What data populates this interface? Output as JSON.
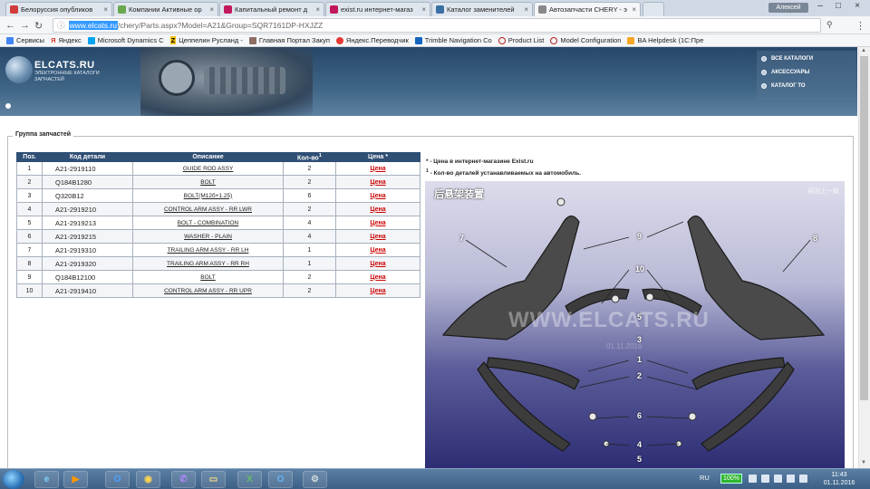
{
  "browser": {
    "tabs": [
      {
        "label": "Белоруссия опубликов",
        "color": "#d23b3b"
      },
      {
        "label": "Компании Активные ор",
        "color": "#6aa84f"
      },
      {
        "label": "Капитальный ремонт д",
        "color": "#c2185b",
        "letter": "D"
      },
      {
        "label": "exist.ru интернет-магаз",
        "color": "#c2185b",
        "letter": "!"
      },
      {
        "label": "Каталог заменителей",
        "color": "#3a6ea5"
      },
      {
        "label": "Автозапчасти CHERY - э",
        "color": "#888888"
      }
    ],
    "account_label": "Алексей",
    "url_host": "www.elcats.ru",
    "url_path": "/chery/Parts.aspx?Model=A21&Group=SQR7161DP-HXJZZ"
  },
  "bookmarks": [
    {
      "label": "Сервисы",
      "color": "#4285f4"
    },
    {
      "label": "Яндекс",
      "color": "#e53935",
      "letter": "Я"
    },
    {
      "label": "Microsoft Dynamics C",
      "color": "#00a4ef"
    },
    {
      "label": "Цеппелин Русланд -",
      "color": "#f4c20d",
      "letter": "Z"
    },
    {
      "label": "Главная Портал Закуп",
      "color": "#8d6e63"
    },
    {
      "label": "Яндекс.Переводчик",
      "color": "#e53935"
    },
    {
      "label": "Trimble Navigation Co",
      "color": "#1565c0"
    },
    {
      "label": "Product List",
      "color": "#b71c1c"
    },
    {
      "label": "Model Configuration",
      "color": "#b71c1c"
    },
    {
      "label": "BA Helpdesk (1С:Пре",
      "color": "#f9a825"
    }
  ],
  "site": {
    "logo": "ELCATS.RU",
    "logo_sub": "ЭЛЕКТРОННЫЕ КАТАЛОГИ ЗАПЧАСТЕЙ",
    "menu": [
      "ВСЕ КАТАЛОГИ",
      "АКСЕССУАРЫ",
      "КАТАЛОГ ТО"
    ]
  },
  "group_legend": "Группа запчастей",
  "table": {
    "headers": [
      "Поз.",
      "Код детали",
      "Описание",
      "Кол-во",
      "Цена *"
    ],
    "qty_sup": "1",
    "rows": [
      {
        "pos": "1",
        "code": "A21-2919110",
        "desc": "GUIDE ROD ASSY",
        "qty": "2",
        "price": "Цена"
      },
      {
        "pos": "2",
        "code": "Q184B1280",
        "desc": "BOLT",
        "qty": "2",
        "price": "Цена"
      },
      {
        "pos": "3",
        "code": "Q320B12",
        "desc": "BOLT(M12б+1.25)",
        "qty": "6",
        "price": "Цена"
      },
      {
        "pos": "4",
        "code": "A21-2919210",
        "desc": "CONTROL ARM ASSY - RR LWR",
        "qty": "2",
        "price": "Цена"
      },
      {
        "pos": "5",
        "code": "A21-2919213",
        "desc": "BOLT - COMBINATION",
        "qty": "4",
        "price": "Цена"
      },
      {
        "pos": "6",
        "code": "A21-2919215",
        "desc": "WASHER - PLAIN",
        "qty": "4",
        "price": "Цена"
      },
      {
        "pos": "7",
        "code": "A21-2919310",
        "desc": "TRAILING ARM ASSY - RR LH",
        "qty": "1",
        "price": "Цена"
      },
      {
        "pos": "8",
        "code": "A21-2919320",
        "desc": "TRAILING ARM ASSY - RR RH",
        "qty": "1",
        "price": "Цена"
      },
      {
        "pos": "9",
        "code": "Q184B12100",
        "desc": "BOLT",
        "qty": "2",
        "price": "Цена"
      },
      {
        "pos": "10",
        "code": "A21-2919410",
        "desc": "CONTROL ARM ASSY - RR UPR",
        "qty": "2",
        "price": "Цена"
      }
    ]
  },
  "notes": {
    "price_mark": "*",
    "price_note": " - Цена в интернет-магазине Exist.ru",
    "qty_mark": "1",
    "qty_note": " - Кол-во деталей устанавливаемых на автомобиль."
  },
  "diagram": {
    "title": "后悬架装置",
    "link": "返回上一级",
    "watermark": "WWW.ELCATS.RU",
    "watermark_date": "01.11.2016",
    "callouts": [
      "7",
      "8",
      "9",
      "10",
      "5",
      "3",
      "1",
      "2",
      "6",
      "4",
      "5"
    ]
  },
  "taskbar": {
    "lang": "RU",
    "battery": "100%",
    "time": "11:43",
    "date": "01.11.2016"
  }
}
